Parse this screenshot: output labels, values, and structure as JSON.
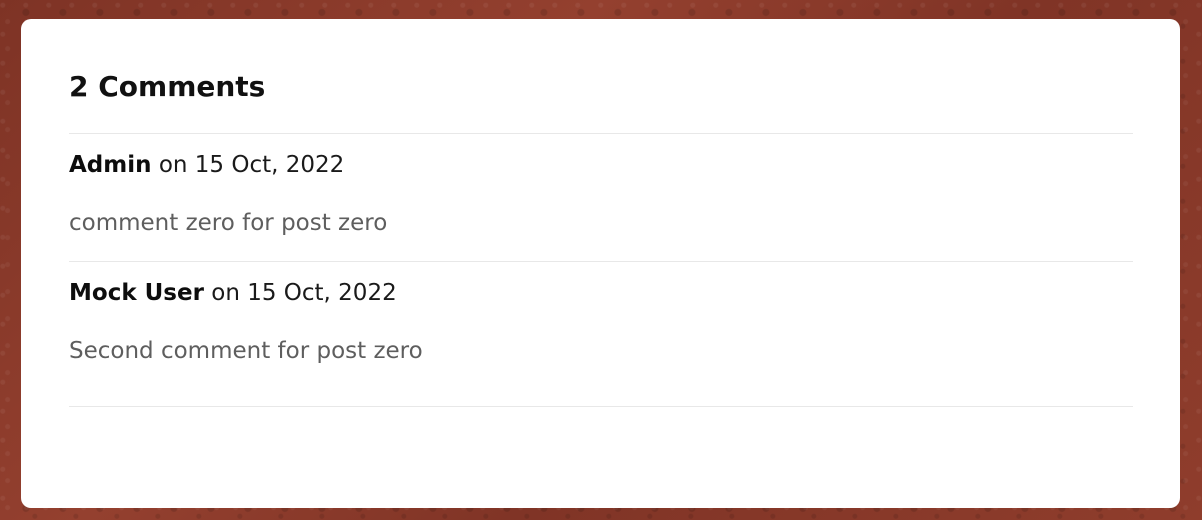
{
  "comments_section": {
    "title": "2 Comments",
    "comments": [
      {
        "author": "Admin",
        "date_text": "on 15 Oct, 2022",
        "body": "comment zero for post zero"
      },
      {
        "author": "Mock User",
        "date_text": "on 15 Oct, 2022",
        "body": "Second comment for post zero"
      }
    ]
  }
}
